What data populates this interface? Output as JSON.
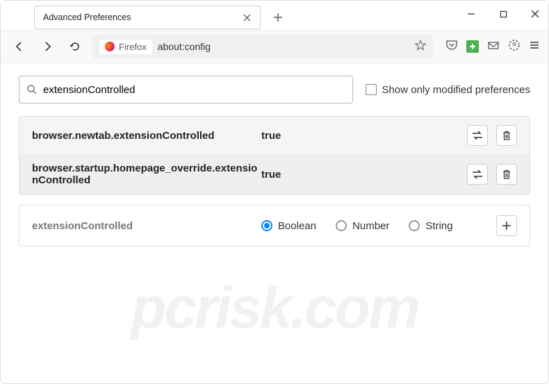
{
  "window": {
    "tab_title": "Advanced Preferences"
  },
  "urlbar": {
    "identity": "Firefox",
    "url": "about:config"
  },
  "search": {
    "value": "extensionControlled",
    "checkbox_label": "Show only modified preferences"
  },
  "prefs": [
    {
      "name": "browser.newtab.extensionControlled",
      "value": "true"
    },
    {
      "name": "browser.startup.homepage_override.extensionControlled",
      "value": "true"
    }
  ],
  "newpref": {
    "name": "extensionControlled",
    "types": [
      "Boolean",
      "Number",
      "String"
    ],
    "selected": "Boolean"
  },
  "watermark": "pcrisk.com"
}
